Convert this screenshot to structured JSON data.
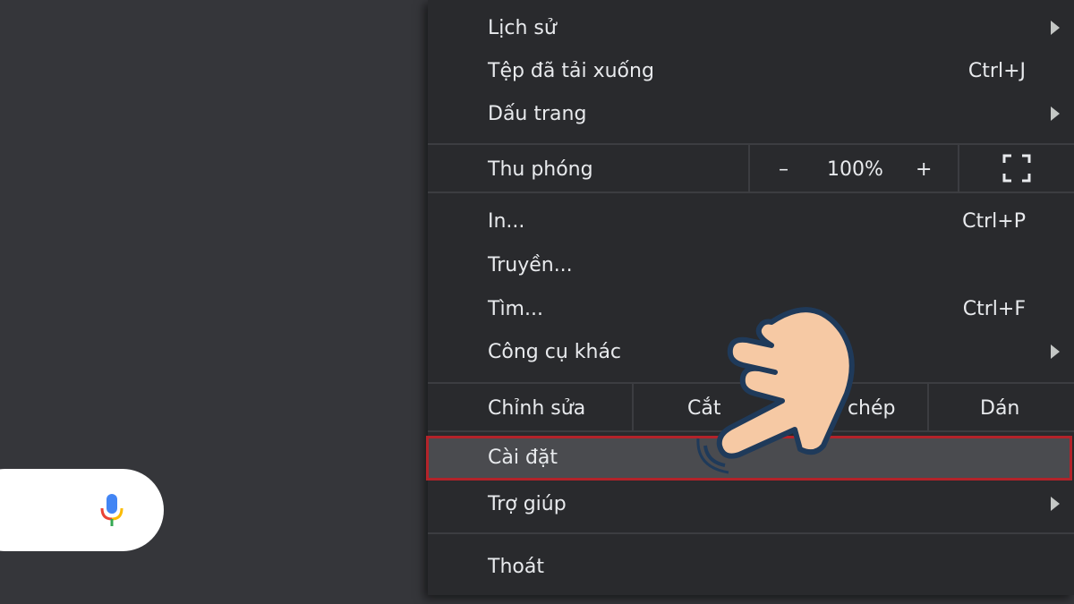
{
  "menu": {
    "items": {
      "history": "Lịch sử",
      "downloads": "Tệp đã tải xuống",
      "downloads_shortcut": "Ctrl+J",
      "bookmarks": "Dấu trang",
      "print": "In...",
      "print_shortcut": "Ctrl+P",
      "cast": "Truyền...",
      "find": "Tìm...",
      "find_shortcut": "Ctrl+F",
      "more_tools": "Công cụ khác",
      "settings": "Cài đặt",
      "help": "Trợ giúp",
      "exit": "Thoát"
    },
    "zoom": {
      "label": "Thu phóng",
      "minus": "–",
      "value": "100%",
      "plus": "+"
    },
    "edit": {
      "label": "Chỉnh sửa",
      "cut": "Cắt",
      "copy": "p chép",
      "paste": "Dán"
    }
  },
  "icons": {
    "submenu": "chevron-right-icon",
    "fullscreen": "fullscreen-icon",
    "mic": "microphone-icon",
    "hand": "pointing-hand-icon"
  },
  "colors": {
    "page_bg": "#35363a",
    "menu_bg": "#292a2d",
    "highlight_border": "#b3232a",
    "text": "#e8eaed"
  }
}
